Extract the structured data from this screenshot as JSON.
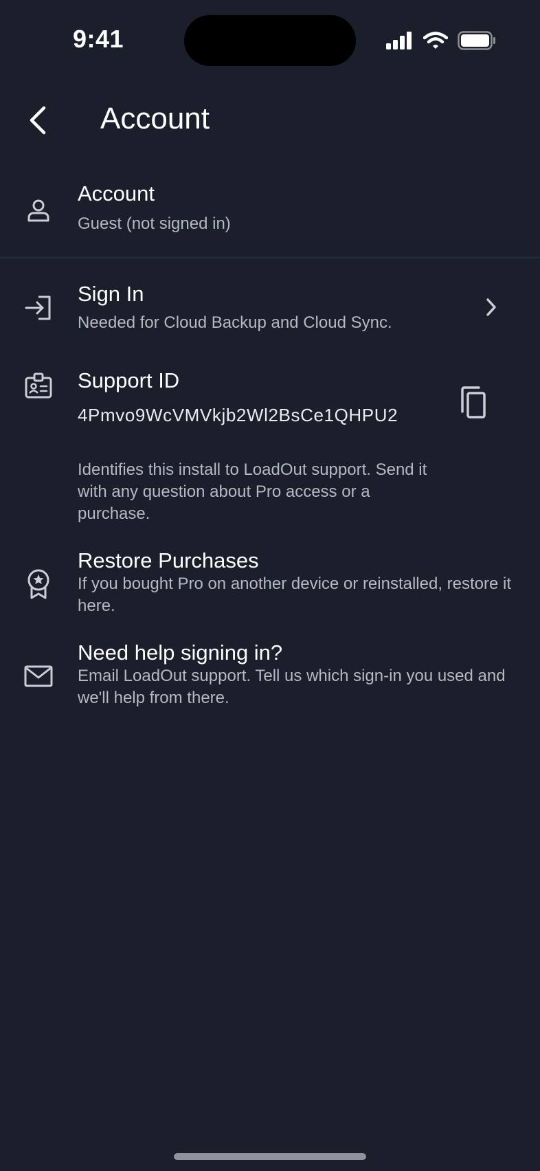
{
  "status_bar": {
    "time": "9:41"
  },
  "header": {
    "title": "Account"
  },
  "account": {
    "title": "Account",
    "status": "Guest (not signed in)"
  },
  "sign_in": {
    "title": "Sign In",
    "subtitle": "Needed for Cloud Backup and Cloud Sync."
  },
  "support": {
    "title": "Support ID",
    "id_value": "4Pmvo9WcVMVkjb2Wl2BsCe1QHPU2",
    "description": "Identifies this install to LoadOut support. Send it with any question about Pro access or a purchase."
  },
  "restore": {
    "title": "Restore Purchases",
    "subtitle": "If you bought Pro on another device or reinstalled, restore it here."
  },
  "help": {
    "title": "Need help signing in?",
    "subtitle": "Email LoadOut support. Tell us which sign-in you used and we'll help from there."
  },
  "icons": {
    "back": "chevron-left-icon",
    "account": "person-icon",
    "sign_in": "login-arrow-icon",
    "support": "id-badge-icon",
    "copy": "copy-icon",
    "restore": "award-ribbon-icon",
    "help": "mail-icon"
  },
  "colors": {
    "background": "#1a1f2b",
    "secondary_text": "#b4b9c4",
    "icon": "#c9ced8"
  }
}
